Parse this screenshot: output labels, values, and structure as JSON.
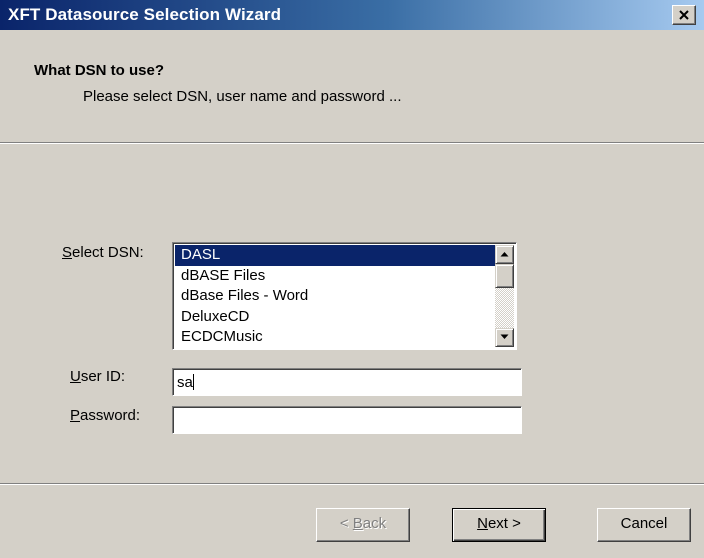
{
  "window": {
    "title": "XFT Datasource Selection Wizard"
  },
  "header": {
    "title": "What DSN to use?",
    "subtitle": "Please select DSN, user name and password  ..."
  },
  "form": {
    "dsn_label_mnemonic": "S",
    "dsn_label_rest": "elect DSN:",
    "dsn_items": [
      "DASL",
      "dBASE Files",
      "dBase Files - Word",
      "DeluxeCD",
      "ECDCMusic"
    ],
    "dsn_selected": "DASL",
    "userid_label_mnemonic": "U",
    "userid_label_rest": "ser ID:",
    "userid_value": "sa",
    "password_label_mnemonic": "P",
    "password_label_rest": "assword:",
    "password_value": ""
  },
  "buttons": {
    "back_prefix": "< ",
    "back_mnemonic": "B",
    "back_rest": "ack",
    "next_mnemonic": "N",
    "next_rest": "ext >",
    "cancel": "Cancel"
  },
  "icons": {
    "close": "close-icon",
    "scroll_up": "arrow-up-icon",
    "scroll_down": "arrow-down-icon"
  },
  "colors": {
    "titlebar_start": "#0a246a",
    "titlebar_end": "#a6caf0",
    "selection": "#0a246a",
    "face": "#d4d0c8"
  }
}
